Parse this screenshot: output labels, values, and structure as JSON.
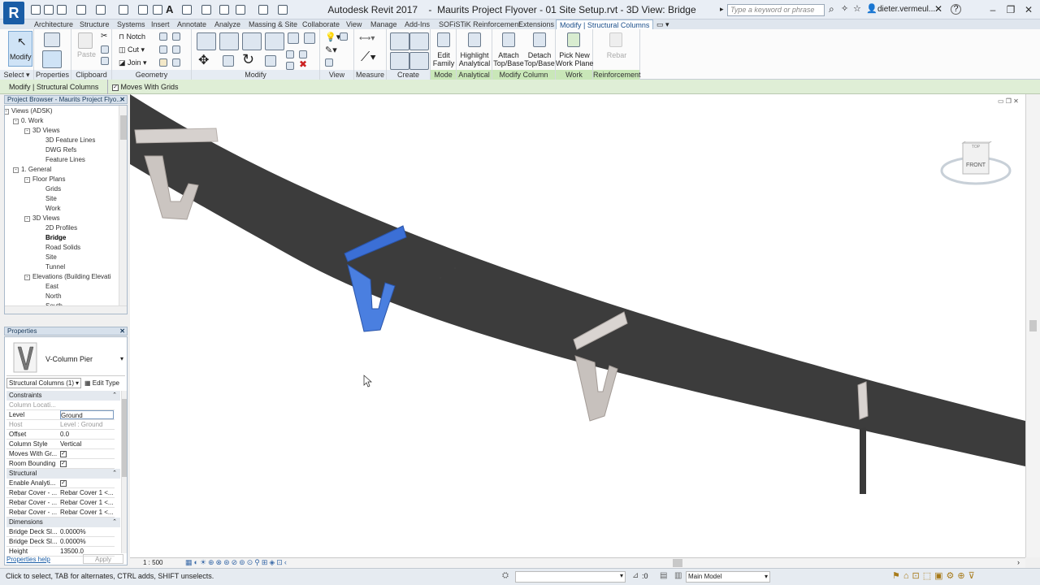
{
  "titlebar": {
    "app": "Autodesk Revit 2017",
    "separator": "-",
    "document": "Maurits Project Flyover - 01 Site Setup.rvt - 3D View: Bridge",
    "search_placeholder": "Type a keyword or phrase",
    "user": "dieter.vermeul...",
    "app_letter": "R"
  },
  "tabs": [
    "Architecture",
    "Structure",
    "Systems",
    "Insert",
    "Annotate",
    "Analyze",
    "Massing & Site",
    "Collaborate",
    "View",
    "Manage",
    "Add-Ins",
    "SOFiSTiK Reinforcement",
    "Extensions",
    "Modify | Structural Columns"
  ],
  "ribbon": {
    "select": {
      "modify": "Modify",
      "label": "Select"
    },
    "properties": {
      "label": "Properties",
      "button": "Properties"
    },
    "clipboard": {
      "paste": "Paste",
      "label": "Clipboard"
    },
    "geometry": {
      "notch": "Notch",
      "cut": "Cut",
      "join": "Join",
      "label": "Geometry"
    },
    "modify": {
      "label": "Modify"
    },
    "view": {
      "label": "View"
    },
    "measure": {
      "label": "Measure"
    },
    "create": {
      "label": "Create"
    },
    "mode": {
      "edit": "Edit",
      "family": "Family",
      "label": "Mode"
    },
    "analytical": {
      "line1": "Highlight",
      "line2": "Analytical",
      "label": "Analytical"
    },
    "modify_column": {
      "attach1": "Attach",
      "attach2": "Top/Base",
      "detach1": "Detach",
      "detach2": "Top/Base",
      "label": "Modify Column"
    },
    "work_plane": {
      "line1": "Pick New",
      "line2": "Work Plane",
      "label": "Work Plane"
    },
    "reinforcement": {
      "rebar": "Rebar",
      "label": "Reinforcement"
    }
  },
  "options_bar": {
    "context": "Modify | Structural Columns",
    "moves_with_grids": "Moves With Grids"
  },
  "project_browser": {
    "title": "Project Browser - Maurits Project Flyo...",
    "items": [
      {
        "label": "Views (ADSK)",
        "level": 0,
        "toggle": "-"
      },
      {
        "label": "0. Work",
        "level": 1,
        "toggle": "-"
      },
      {
        "label": "3D Views",
        "level": 2,
        "toggle": "-"
      },
      {
        "label": "3D Feature Lines",
        "level": 3
      },
      {
        "label": "DWG Refs",
        "level": 3
      },
      {
        "label": "Feature Lines",
        "level": 3
      },
      {
        "label": "1. General",
        "level": 1,
        "toggle": "-"
      },
      {
        "label": "Floor Plans",
        "level": 2,
        "toggle": "-"
      },
      {
        "label": "Grids",
        "level": 3
      },
      {
        "label": "Site",
        "level": 3
      },
      {
        "label": "Work",
        "level": 3
      },
      {
        "label": "3D Views",
        "level": 2,
        "toggle": "-"
      },
      {
        "label": "2D Profiles",
        "level": 3
      },
      {
        "label": "Bridge",
        "level": 3,
        "selected": true
      },
      {
        "label": "Road Solids",
        "level": 3
      },
      {
        "label": "Site",
        "level": 3
      },
      {
        "label": "Tunnel",
        "level": 3
      },
      {
        "label": "Elevations (Building Elevati",
        "level": 2,
        "toggle": "-"
      },
      {
        "label": "East",
        "level": 3
      },
      {
        "label": "North",
        "level": 3
      },
      {
        "label": "South",
        "level": 3
      }
    ]
  },
  "properties": {
    "title": "Properties",
    "family": "V-Column Pier",
    "selector": "Structural Columns (1)",
    "edit_type": "Edit Type",
    "groups": [
      {
        "name": "Constraints",
        "rows": [
          {
            "k": "Column Locati...",
            "v": "",
            "gray": true
          },
          {
            "k": "Level",
            "v": "Ground"
          },
          {
            "k": "Host",
            "v": "Level : Ground",
            "gray": true
          },
          {
            "k": "Offset",
            "v": "0.0"
          },
          {
            "k": "Column Style",
            "v": "Vertical"
          },
          {
            "k": "Moves With Gr...",
            "v": "check"
          },
          {
            "k": "Room Bounding",
            "v": "check"
          }
        ]
      },
      {
        "name": "Structural",
        "rows": [
          {
            "k": "Enable Analyti...",
            "v": "check"
          },
          {
            "k": "Rebar Cover - ...",
            "v": "Rebar Cover 1 <..."
          },
          {
            "k": "Rebar Cover - ...",
            "v": "Rebar Cover 1 <..."
          },
          {
            "k": "Rebar Cover - ...",
            "v": "Rebar Cover 1 <..."
          }
        ]
      },
      {
        "name": "Dimensions",
        "rows": [
          {
            "k": "Bridge Deck Sl...",
            "v": "0.0000%"
          },
          {
            "k": "Bridge Deck Sl...",
            "v": "0.0000%"
          },
          {
            "k": "Height",
            "v": "13500.0"
          }
        ]
      }
    ],
    "help": "Properties help",
    "apply": "Apply"
  },
  "viewcube": {
    "face": "FRONT",
    "top": "TOP"
  },
  "view_control": {
    "scale": "1 : 500"
  },
  "statusbar": {
    "hint": "Click to select, TAB for alternates, CTRL adds, SHIFT unselects.",
    "count": ":0",
    "model": "Main Model"
  },
  "colors": {
    "accent": "#1a5da6",
    "selection": "#3b6fd6",
    "deck": "#3c3c3c",
    "pier": "#d9d4d1"
  }
}
